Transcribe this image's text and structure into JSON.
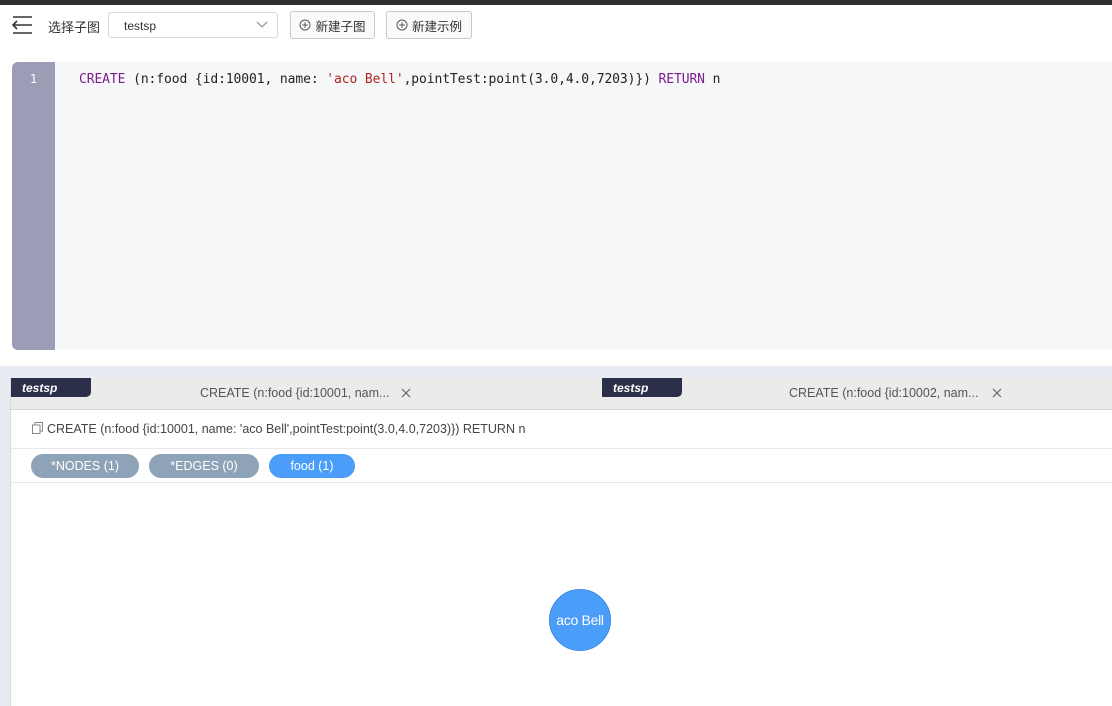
{
  "toolbar": {
    "select_label": "选择子图",
    "graph_select_value": "testsp",
    "new_graph_label": "新建子图",
    "new_example_label": "新建示例"
  },
  "editor": {
    "line_number": "1",
    "code_tokens": [
      {
        "t": "CREATE",
        "c": "kw"
      },
      {
        "t": " (n:food {id:10001, name: ",
        "c": ""
      },
      {
        "t": "'aco Bell'",
        "c": "str"
      },
      {
        "t": ",pointTest:point(3.0,4.0,7203)}) ",
        "c": ""
      },
      {
        "t": "RETURN",
        "c": "kw"
      },
      {
        "t": " n",
        "c": ""
      }
    ]
  },
  "tabs": [
    {
      "badge": "testsp",
      "title": "CREATE (n:food {id:10001, nam..."
    },
    {
      "badge": "testsp",
      "title": "CREATE (n:food {id:10002, nam..."
    }
  ],
  "result": {
    "query_text": "CREATE (n:food {id:10001, name: 'aco Bell',pointTest:point(3.0,4.0,7203)}) RETURN n",
    "filters": [
      {
        "label": "*NODES (1)",
        "color": "#8fa3b8"
      },
      {
        "label": "*EDGES (0)",
        "color": "#8fa3b8"
      },
      {
        "label": "food (1)",
        "color": "#4a9df8"
      }
    ],
    "node_label": "aco Bell"
  },
  "colors": {
    "accent": "#4a9df8",
    "tab_badge": "#2b2f4a",
    "gutter": "#9a9db5"
  }
}
